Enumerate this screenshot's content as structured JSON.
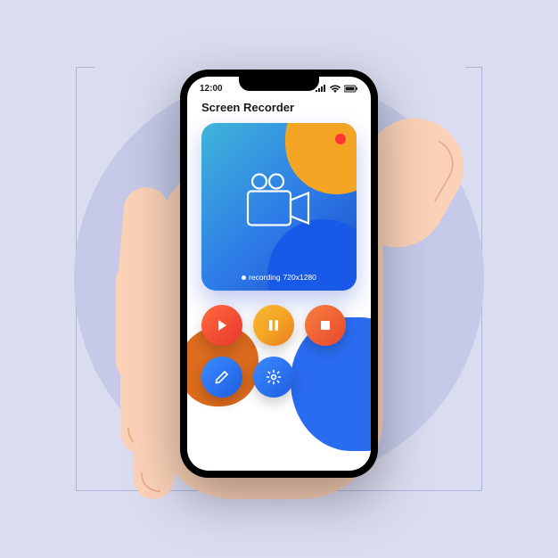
{
  "status": {
    "time": "12:00"
  },
  "app": {
    "title": "Screen Recorder"
  },
  "preview": {
    "recording_label": "recording",
    "resolution": "720x1280"
  },
  "buttons": {
    "play": "play",
    "pause": "pause",
    "stop": "stop",
    "edit": "edit",
    "settings": "settings"
  },
  "colors": {
    "accent_blue": "#2a6cf0",
    "accent_orange": "#f5a524",
    "record_red": "#ff3535"
  }
}
